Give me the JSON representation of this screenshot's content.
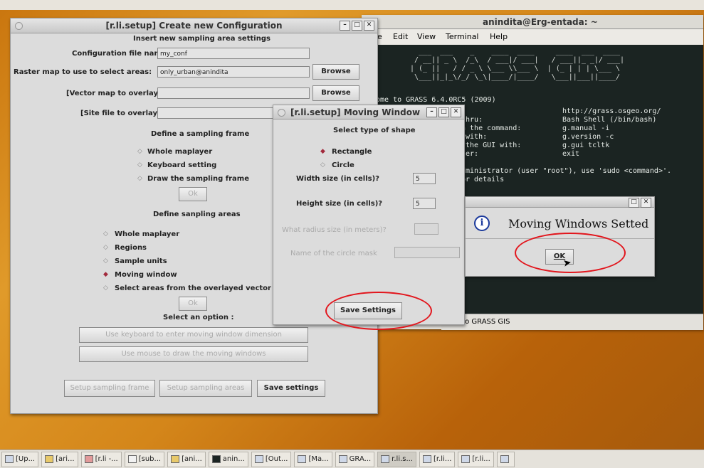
{
  "terminal": {
    "title": "anindita@Erg-entada: ~",
    "menu": [
      "e",
      "Edit",
      "View",
      "Terminal",
      "Help"
    ],
    "ascii_art": "  ___  ___    _    ____  ____     ____  ___  ____\n / __|| _ \\  /_\\  / ___|/ ___|   / ___||_ _|/ ___|\n| (_ ||   / / _ \\ \\___ \\\\___ \\  | (_ | | | \\___ \\\n \\___||_|_\\/_/ \\_\\|____/|____/   \\___||___||____/",
    "lines": [
      {
        "l": "come to GRASS 6.4.0RC5 (2009)",
        "r": ""
      },
      {
        "l": "",
        "r": "http://grass.osgeo.org/"
      },
      {
        "l": "thru:",
        "r": "Bash Shell (/bin/bash)"
      },
      {
        "l": "h the command:",
        "r": "g.manual -i"
      },
      {
        "l": " with:",
        "r": "g.version -c"
      },
      {
        "l": " the GUI with:",
        "r": "g.gui tcltk"
      },
      {
        "l": "ter:",
        "r": "exit"
      },
      {
        "l": "",
        "r": ""
      },
      {
        "l": "dministrator (user \"root\"), use 'sudo <command>'.",
        "r": ""
      },
      {
        "l": "or details",
        "r": ""
      }
    ],
    "status": "ome to GRASS GIS"
  },
  "config": {
    "title": "[r.li.setup] Create new Configuration",
    "header": "Insert new sampling area settings",
    "config_label": "Configuration file name:",
    "config_value": "my_conf",
    "raster_label": "Raster map to use to select areas:",
    "raster_value": "only_urban@anindita",
    "vector_label": "[Vector map to overlay:]",
    "site_label": "[Site file to overlay:]",
    "browse": "Browse",
    "frame_header": "Define a sampling frame",
    "frame_opts": [
      "Whole maplayer",
      "Keyboard setting",
      "Draw the sampling frame"
    ],
    "ok": "Ok",
    "areas_header": "Define sanpling areas",
    "area_opts": [
      "Whole maplayer",
      "Regions",
      "Sample units",
      "Moving window",
      "Select areas from the overlayed vector map"
    ],
    "option_header": "Select an option :",
    "keyboard_btn": "Use keyboard to enter moving window dimension",
    "mouse_btn": "Use mouse to draw the moving windows",
    "setup_frame": "Setup sampling frame",
    "setup_areas": "Setup sampling areas",
    "save": "Save settings"
  },
  "moving": {
    "title": "[r.li.setup] Moving Window",
    "header": "Select type of shape",
    "shapes": [
      "Rectangle",
      "Circle"
    ],
    "width_label": "Width size (in cells)?",
    "width_value": "5",
    "height_label": "Height size (in cells)?",
    "height_value": "5",
    "radius_label": "What radius size (in meters)?",
    "mask_label": "Name of the circle mask",
    "save": "Save Settings"
  },
  "dialog": {
    "message": "Moving Windows Setted",
    "ok": "OK"
  },
  "taskbar": [
    "[Up...",
    "[ari...",
    "[r.li -...",
    "[sub...",
    "[ani...",
    "anin...",
    "[Out...",
    "[Ma...",
    "GRA...",
    "r.li.s...",
    "[r.li...",
    "[r.li...",
    ""
  ],
  "colors": {
    "accent_red": "#e2161d",
    "radio_on": "#a22a3c",
    "terminal_bg": "#1b2422"
  }
}
